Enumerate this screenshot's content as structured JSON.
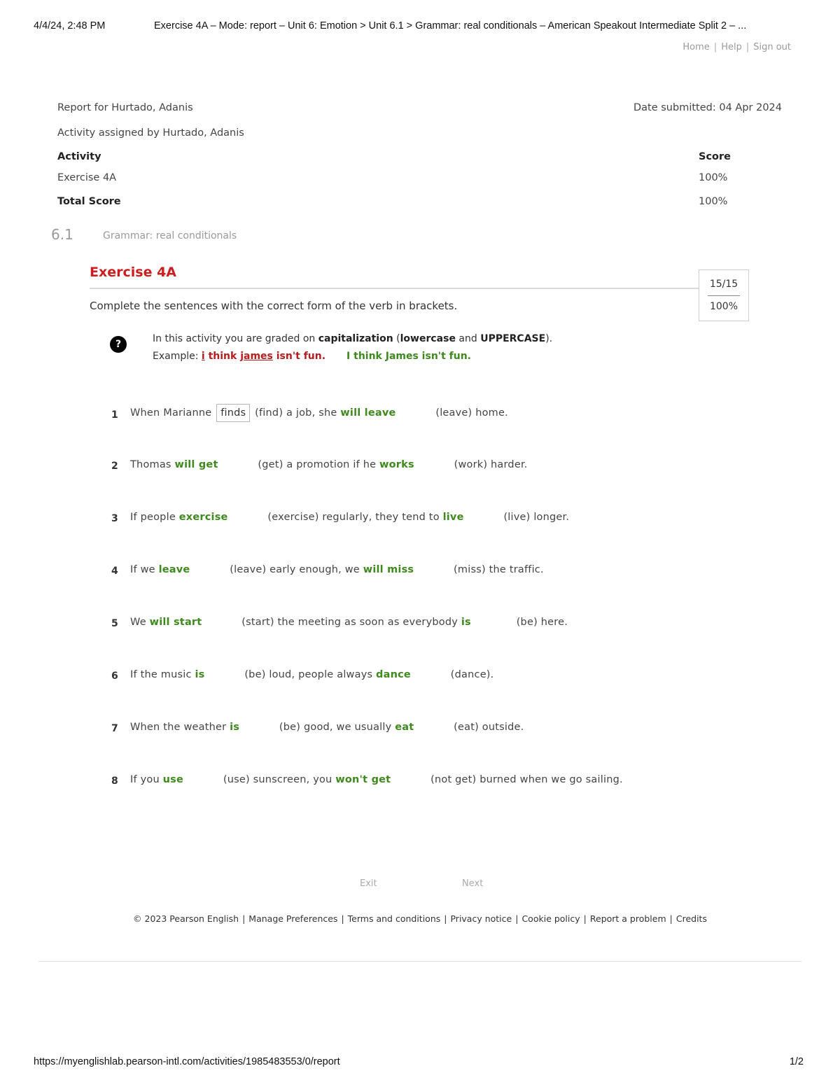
{
  "print_header": {
    "timestamp": "4/4/24, 2:48 PM",
    "title": "Exercise 4A – Mode: report – Unit 6: Emotion > Unit 6.1 > Grammar: real conditionals – American Speakout Intermediate Split 2 – ..."
  },
  "top_nav": {
    "home": "Home",
    "help": "Help",
    "sign_out": "Sign out",
    "sep": "|"
  },
  "report": {
    "report_for": "Report for Hurtado, Adanis",
    "date_submitted": "Date submitted: 04 Apr 2024",
    "assigned_by": "Activity assigned by Hurtado, Adanis",
    "activity_header": "Activity",
    "score_header": "Score",
    "activity_name": "Exercise 4A",
    "activity_score": "100%",
    "total_label": "Total Score",
    "total_score": "100%"
  },
  "unit": {
    "number": "6.1",
    "title": "Grammar: real conditionals"
  },
  "exercise": {
    "title": "Exercise 4A",
    "instructions": "Complete the sentences with the correct form of the verb in brackets.",
    "score_fraction": "15/15",
    "score_percent": "100%"
  },
  "note": {
    "icon": "?",
    "line1_a": "In this activity you are graded on ",
    "line1_b": "capitalization",
    "line1_c": " (",
    "line1_d": "lowercase",
    "line1_e": " and ",
    "line1_f": "UPPERCASE",
    "line1_g": ").",
    "example_label": "Example: ",
    "wrong_i": "i",
    "wrong_think": " think ",
    "wrong_james": "james",
    "wrong_rest": " isn't fun.",
    "correct": "I think James isn't fun."
  },
  "questions": [
    {
      "num": "1",
      "t1": "When Marianne",
      "a1": "finds",
      "t2": "(find) a job, she",
      "a2": "will leave",
      "t3": "(leave) home."
    },
    {
      "num": "2",
      "t1": "Thomas",
      "a1": "will get",
      "t2": "(get) a promotion if he",
      "a2": "works",
      "t3": "(work) harder."
    },
    {
      "num": "3",
      "t1": "If people",
      "a1": "exercise",
      "t2": "(exercise) regularly, they tend to",
      "a2": "live",
      "t3": "(live) longer."
    },
    {
      "num": "4",
      "t1": "If we",
      "a1": "leave",
      "t2": "(leave) early enough, we",
      "a2": "will miss",
      "t3": "(miss) the traffic."
    },
    {
      "num": "5",
      "t1": "We",
      "a1": "will start",
      "t2": "(start) the meeting as soon as everybody",
      "a2": "is",
      "t3": "(be) here."
    },
    {
      "num": "6",
      "t1": "If the music",
      "a1": "is",
      "t2": "(be) loud, people always",
      "a2": "dance",
      "t3": "(dance)."
    },
    {
      "num": "7",
      "t1": "When the weather",
      "a1": "is",
      "t2": "(be) good, we usually",
      "a2": "eat",
      "t3": "(eat) outside."
    },
    {
      "num": "8",
      "t1": "If you",
      "a1": "use",
      "t2": "(use) sunscreen, you",
      "a2": "won't get",
      "t3": "(not get) burned when we go sailing."
    }
  ],
  "nav_buttons": {
    "exit": "Exit",
    "next": "Next"
  },
  "footer": {
    "copyright": "© 2023 Pearson English",
    "manage": "Manage Preferences",
    "terms": "Terms and conditions",
    "privacy": "Privacy notice",
    "cookie": "Cookie policy",
    "report": "Report a problem",
    "credits": "Credits",
    "sep": "|"
  },
  "print_footer": {
    "url": "https://myenglishlab.pearson-intl.com/activities/1985483553/0/report",
    "page": "1/2"
  },
  "colors": {
    "exercise_title": "#cc1e1e",
    "correct_answer": "#3f8a1e",
    "incorrect": "#b91c1c"
  }
}
